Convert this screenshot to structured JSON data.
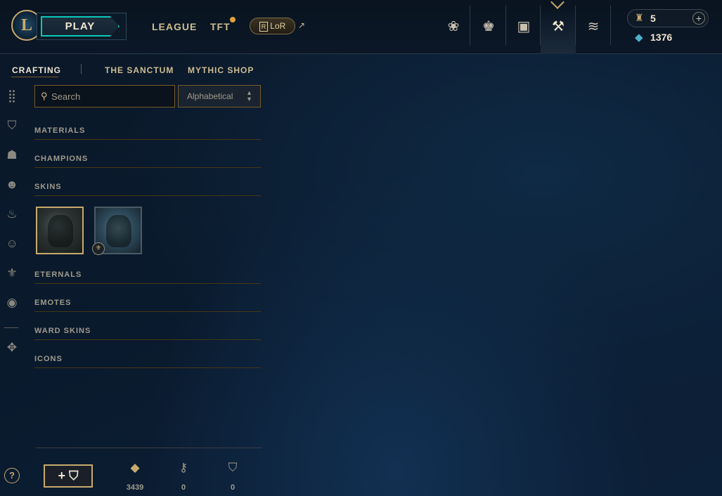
{
  "nav": {
    "logo_letter": "L",
    "play_label": "PLAY",
    "links": [
      "LEAGUE",
      "TFT"
    ],
    "lor_label": "LoR",
    "lor_badge": "R",
    "external_icon": "↗",
    "icons": [
      {
        "name": "lotus-icon",
        "glyph": "❀"
      },
      {
        "name": "trophy-icon",
        "glyph": "♚"
      },
      {
        "name": "briefcase-icon",
        "glyph": "▣"
      },
      {
        "name": "crafting-icon",
        "glyph": "⚒"
      },
      {
        "name": "coins-icon",
        "glyph": "≋"
      }
    ]
  },
  "currency": {
    "rp_icon": "♜",
    "rp_value": "5",
    "add_label": "+",
    "be_icon": "◆",
    "be_value": "1376"
  },
  "subtabs": [
    "CRAFTING",
    "THE SANCTUM",
    "MYTHIC SHOP"
  ],
  "sidebar_icons": [
    {
      "name": "all-items-icon",
      "glyph": "⣿"
    },
    {
      "name": "chest-icon",
      "glyph": "⛉"
    },
    {
      "name": "champion-helmet-icon",
      "glyph": "☗"
    },
    {
      "name": "skin-mask-icon",
      "glyph": "☻"
    },
    {
      "name": "ward-flame-icon",
      "glyph": "♨"
    },
    {
      "name": "emote-icon",
      "glyph": "☺"
    },
    {
      "name": "eternals-icon",
      "glyph": "⚜"
    },
    {
      "name": "summoner-icon-icon",
      "glyph": "◉"
    },
    {
      "name": "tft-icon",
      "glyph": "✥"
    }
  ],
  "search": {
    "placeholder": "Search",
    "icon": "⚲"
  },
  "sort": {
    "selected": "Alphabetical",
    "chevron": "⌃⌄"
  },
  "categories": [
    "MATERIALS",
    "CHAMPIONS",
    "SKINS",
    "ETERNALS",
    "EMOTES",
    "WARD SKINS",
    "ICONS"
  ],
  "skin_badge": "⚜",
  "footer": {
    "help": "?",
    "add_chest_label": "+ ⛉",
    "resources": [
      {
        "name": "orange-essence",
        "icon": "◆",
        "color": "#c8aa6e",
        "value": "3439"
      },
      {
        "name": "key",
        "icon": "⚷",
        "color": "#a09b8c",
        "value": "0"
      },
      {
        "name": "chest",
        "icon": "⛉",
        "color": "#a09b8c",
        "value": "0"
      }
    ]
  }
}
